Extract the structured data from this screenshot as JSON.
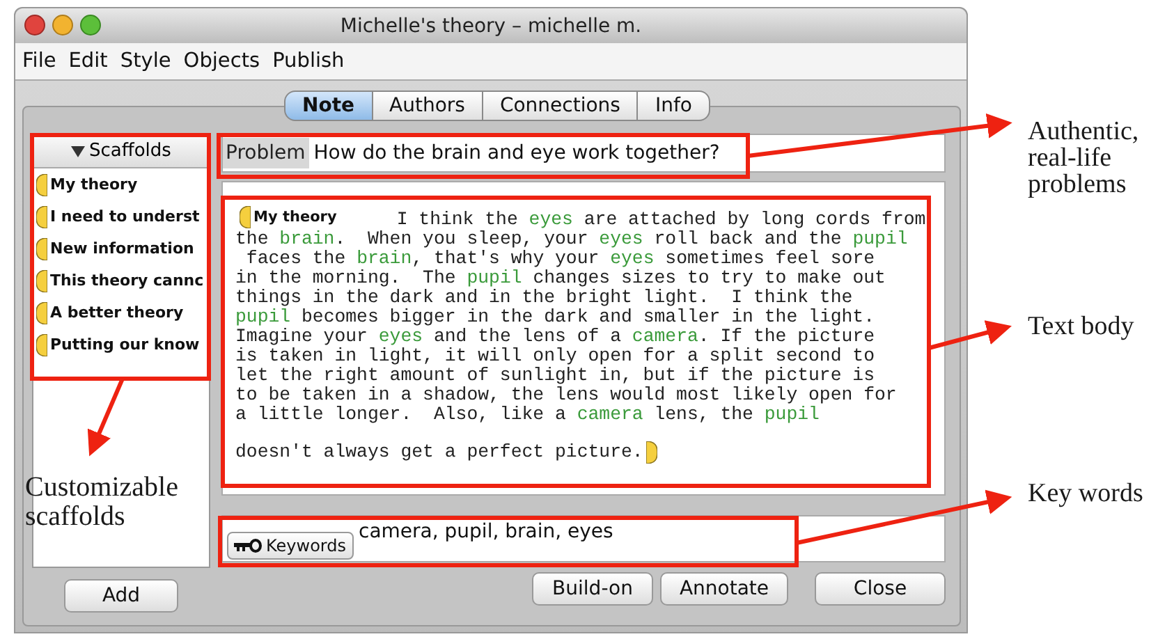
{
  "window": {
    "title": "Michelle's theory – michelle m."
  },
  "menu": [
    "File",
    "Edit",
    "Style",
    "Objects",
    "Publish"
  ],
  "tabs": [
    {
      "label": "Note",
      "selected": true
    },
    {
      "label": "Authors",
      "selected": false
    },
    {
      "label": "Connections",
      "selected": false
    },
    {
      "label": "Info",
      "selected": false
    }
  ],
  "scaffolds": {
    "header": "Scaffolds",
    "expanded": true,
    "items": [
      "My theory",
      "I need to underst",
      "New information",
      "This theory cannc",
      "A better theory",
      "Putting our know"
    ],
    "add_button": "Add"
  },
  "problem": {
    "label": "Problem",
    "value": "How do the brain and eye work together?"
  },
  "note_body": {
    "scaffold_label": "My theory",
    "lines": [
      [
        {
          "text": "  I think the ",
          "keyword": false
        },
        {
          "text": "eyes",
          "keyword": true
        },
        {
          "text": " are attached by long cords from",
          "keyword": false
        }
      ],
      [
        {
          "text": "the ",
          "keyword": false
        },
        {
          "text": "brain",
          "keyword": true
        },
        {
          "text": ".  When you sleep, your ",
          "keyword": false
        },
        {
          "text": "eyes",
          "keyword": true
        },
        {
          "text": " roll back and the ",
          "keyword": false
        },
        {
          "text": "pupil",
          "keyword": true
        }
      ],
      [
        {
          "text": " faces the ",
          "keyword": false
        },
        {
          "text": "brain",
          "keyword": true
        },
        {
          "text": ", that's why your ",
          "keyword": false
        },
        {
          "text": "eyes",
          "keyword": true
        },
        {
          "text": " sometimes feel sore",
          "keyword": false
        }
      ],
      [
        {
          "text": "in the morning.  The ",
          "keyword": false
        },
        {
          "text": "pupil",
          "keyword": true
        },
        {
          "text": " changes sizes to try to make out",
          "keyword": false
        }
      ],
      [
        {
          "text": "things in the dark and in the bright light.  I think the",
          "keyword": false
        }
      ],
      [
        {
          "text": "pupil",
          "keyword": true
        },
        {
          "text": " becomes bigger in the dark and smaller in the light.",
          "keyword": false
        }
      ],
      [
        {
          "text": "Imagine your ",
          "keyword": false
        },
        {
          "text": "eyes",
          "keyword": true
        },
        {
          "text": " and the lens of a ",
          "keyword": false
        },
        {
          "text": "camera",
          "keyword": true
        },
        {
          "text": ". If the picture",
          "keyword": false
        }
      ],
      [
        {
          "text": "is taken in light, it will only open for a split second to",
          "keyword": false
        }
      ],
      [
        {
          "text": "let the right amount of sunlight in, but if the picture is",
          "keyword": false
        }
      ],
      [
        {
          "text": "to be taken in a shadow, the lens would most likely open for",
          "keyword": false
        }
      ],
      [
        {
          "text": "a little longer.  Also, like a ",
          "keyword": false
        },
        {
          "text": "camera",
          "keyword": true
        },
        {
          "text": " lens, the ",
          "keyword": false
        },
        {
          "text": "pupil",
          "keyword": true
        }
      ]
    ],
    "closing_line": "doesn't always get a perfect picture."
  },
  "keywords": {
    "button": "Keywords",
    "value": "camera, pupil, brain, eyes"
  },
  "buttons": [
    "Build-on",
    "Annotate",
    "Close"
  ],
  "annotations": [
    {
      "lines": [
        "Authentic,",
        "real-life",
        "problems"
      ]
    },
    {
      "lines": [
        "Text body"
      ]
    },
    {
      "lines": [
        "Customizable",
        "scaffolds"
      ]
    },
    {
      "lines": [
        "Key words"
      ]
    }
  ]
}
